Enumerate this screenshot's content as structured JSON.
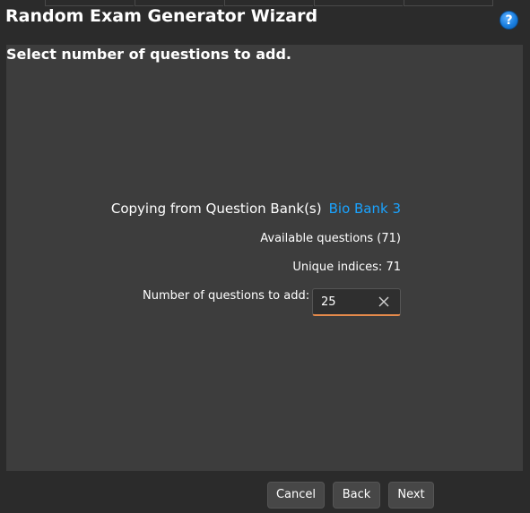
{
  "window": {
    "title": "Random Exam Generator Wizard",
    "help_label": "?"
  },
  "content": {
    "heading": "Select number of questions to add.",
    "copy_label": "Copying from Question Bank(s)",
    "bank_name": "Bio Bank 3",
    "available": "Available questions (71)",
    "unique": "Unique indices: 71",
    "add_label": "Number of questions to add:",
    "add_value": "25"
  },
  "footer": {
    "cancel_label": "Cancel",
    "back_label": "Back",
    "next_label": "Next"
  },
  "colors": {
    "background": "#2b2b2b",
    "panel": "#3d3d3d",
    "link": "#1aa3ff",
    "focus_underline": "#e58a4b",
    "help": "#1a7fe0"
  }
}
